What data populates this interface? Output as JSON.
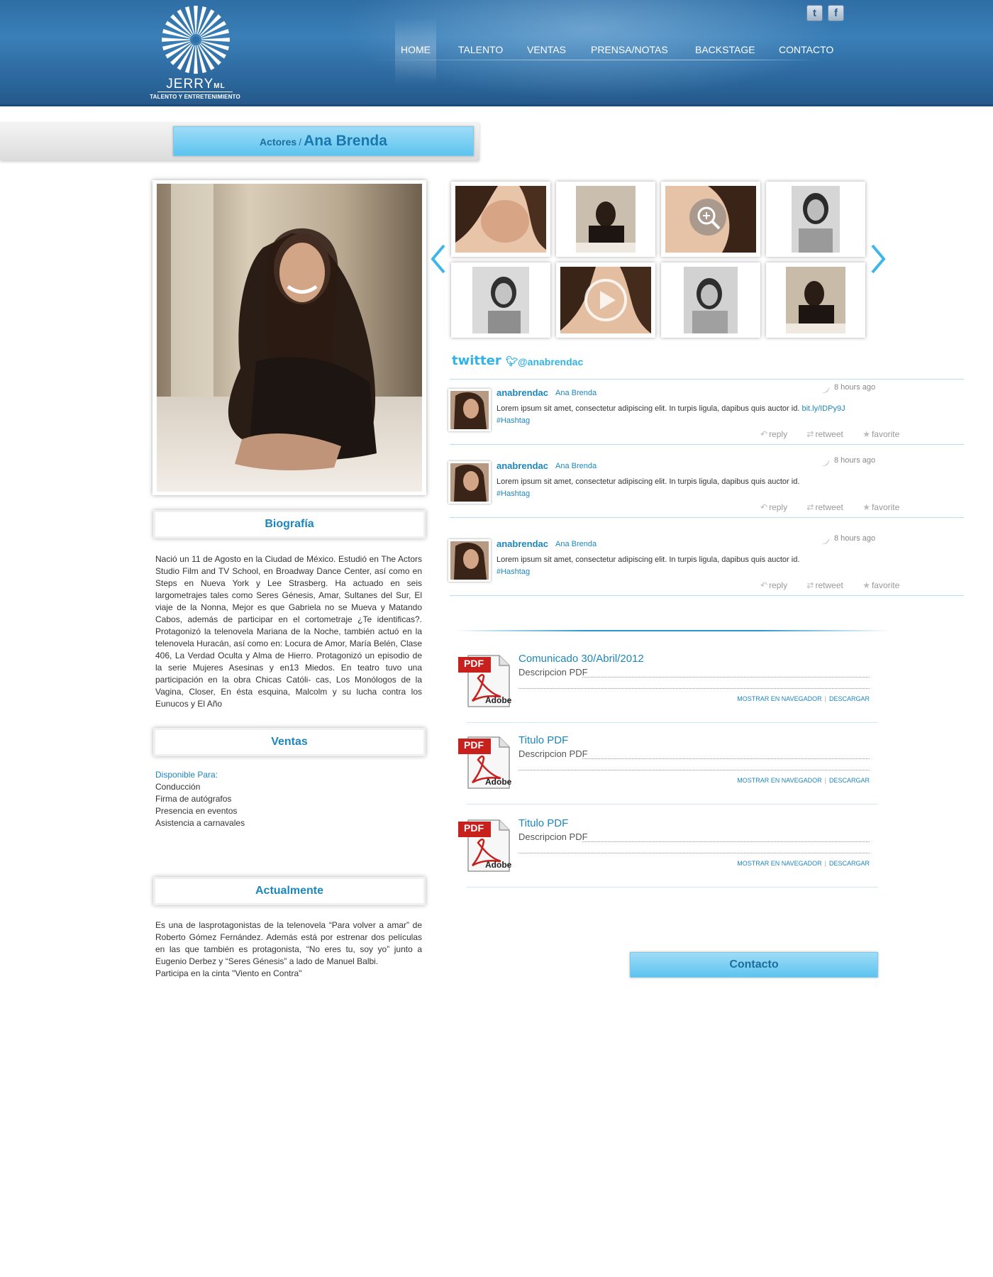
{
  "header": {
    "logo_word": "JERRY",
    "logo_suffix": "ML",
    "logo_tagline": "TALENTO Y ENTRETENIMIENTO",
    "nav": [
      {
        "label": "HOME",
        "active": true
      },
      {
        "label": "TALENTO",
        "active": false
      },
      {
        "label": "VENTAS",
        "active": false
      },
      {
        "label": "PRENSA/NOTAS",
        "active": false
      },
      {
        "label": "BACKSTAGE",
        "active": false
      },
      {
        "label": "CONTACTO",
        "active": false
      }
    ],
    "social": [
      {
        "icon": "twitter-icon",
        "glyph": "t"
      },
      {
        "icon": "facebook-icon",
        "glyph": "f"
      }
    ]
  },
  "breadcrumb": {
    "section": "Actores",
    "separator": "/",
    "name": "Ana Brenda"
  },
  "biografia": {
    "title": "Biografía",
    "text": "Nació un 11 de Agosto en la Ciudad de México. Estudió en The Actors Studio Film and TV School, en Broadway Dance Center, así como en Steps en Nueva York y Lee Strasberg. Ha actuado en seis largometrajes tales como Seres Génesis, Amar, Sultanes del Sur, El viaje de la Nonna, Mejor es que Gabriela no se Mueva y Matando Cabos, además de participar en el cortometraje ¿Te identificas?. Protagonizó la telenovela Mariana de la Noche, también actuó en la telenovela Huracán, así como en: Locura de Amor, María Belén, Clase 406, La Verdad Oculta y Alma de Hierro. Protagonizó un episodio de la serie Mujeres Asesinas y en13 Miedos. En teatro tuvo una participación en la obra Chicas Católi- cas, Los Monólogos de la Vagina, Closer, En ésta esquina, Malcolm y su lucha contra los Eunucos y El Año"
  },
  "ventas": {
    "title": "Ventas",
    "available_label": "Disponible Para:",
    "items": [
      "Conducción",
      "Firma de autógrafos",
      "Presencia en eventos",
      "Asistencia a carnavales"
    ]
  },
  "actualmente": {
    "title": "Actualmente",
    "text": "Es una de lasprotagonistas de la telenovela “Para volver a amar” de Roberto Gómez Fernández. Además está por estrenar dos películas en las que también es protagonista, “No eres tu, soy yo” junto a Eugenio Derbez y “Seres Génesis” a lado de Manuel Balbi.",
    "text2": "Participa en la cinta \"Viento en Contra\""
  },
  "twitter": {
    "logo": "twitter",
    "handle": "@anabrendac",
    "tweets": [
      {
        "user": "anabrendac",
        "name": "Ana Brenda",
        "time": "8 hours ago",
        "text": "Lorem ipsum  sit amet, consectetur adipiscing elit. In turpis ligula, dapibus quis auctor id.",
        "link": "bit.ly/IDPy9J",
        "tag": "#Hashtag"
      },
      {
        "user": "anabrendac",
        "name": "Ana Brenda",
        "time": "8 hours ago",
        "text": "Lorem ipsum  sit amet, consectetur adipiscing elit. In turpis ligula, dapibus quis auctor id.",
        "link": "",
        "tag": "#Hashtag"
      },
      {
        "user": "anabrendac",
        "name": "Ana Brenda",
        "time": "8 hours ago",
        "text": "Lorem ipsum  sit amet, consectetur adipiscing elit. In turpis ligula, dapibus quis auctor id.",
        "link": "",
        "tag": "#Hashtag"
      }
    ],
    "actions": {
      "reply": "reply",
      "retweet": "retweet",
      "favorite": "favorite"
    }
  },
  "pdfs": [
    {
      "title": "Comunicado 30/Abril/2012",
      "desc": "Descripcion PDF",
      "icon_label": "PDF",
      "icon_brand": "Adobe"
    },
    {
      "title": "Titulo PDF",
      "desc": "Descripcion PDF",
      "icon_label": "PDF",
      "icon_brand": "Adobe"
    },
    {
      "title": "Titulo PDF",
      "desc": "Descripcion PDF",
      "icon_label": "PDF",
      "icon_brand": "Adobe"
    }
  ],
  "pdf_links": {
    "view": "MOSTRAR EN NAVEGADOR",
    "sep": "|",
    "download": "DESCARGAR"
  },
  "contact_button": "Contacto",
  "colors": {
    "header": "#2f6ea5",
    "accent": "#1d86bd",
    "pill": "#5cc4ef",
    "twitter": "#33b2e5"
  }
}
